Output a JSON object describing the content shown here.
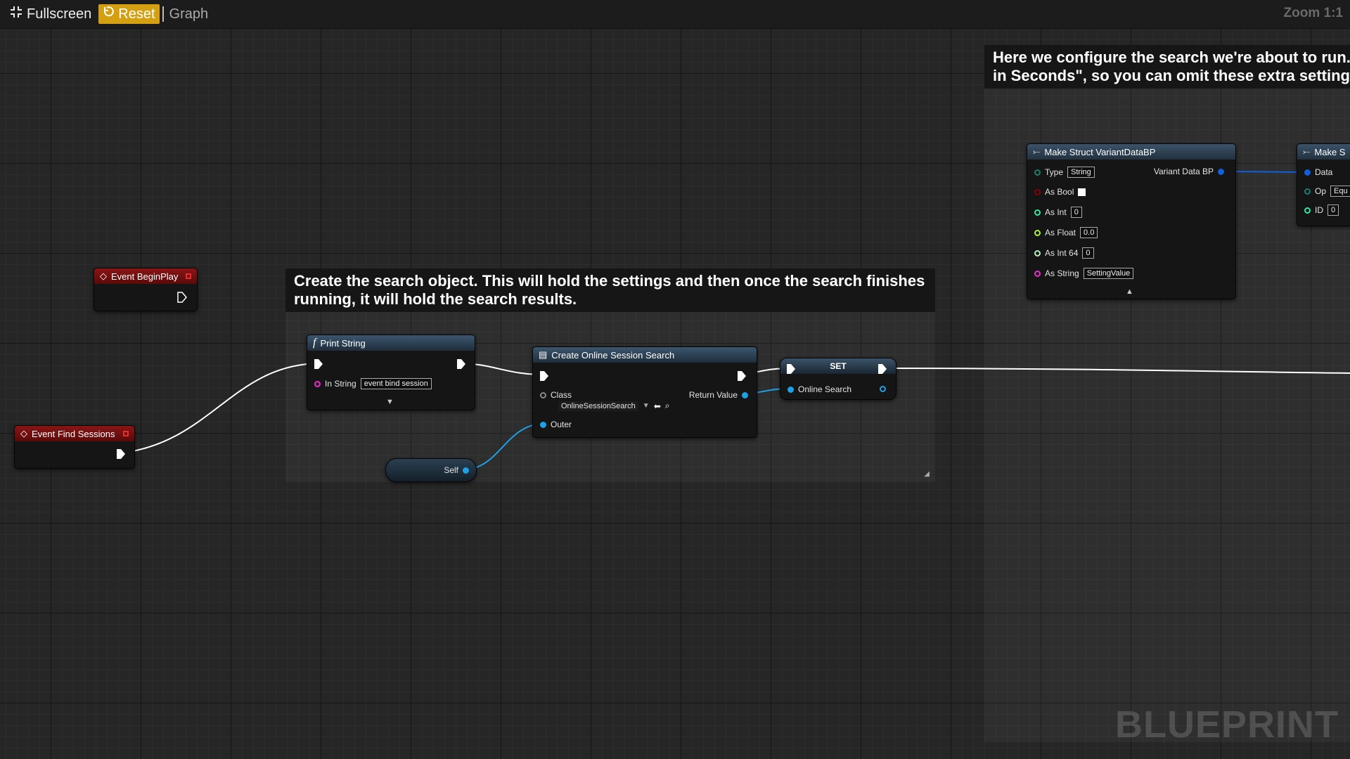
{
  "toolbar": {
    "fullscreen_label": "Fullscreen",
    "reset_label": "Reset",
    "graph_label": "Graph",
    "zoom_label": "Zoom 1:1"
  },
  "comments": {
    "search_config": "Here we configure the search we're about to run.\nin Seconds\", so you can omit these extra setting",
    "create_search": "Create the search object. This will hold the settings and then once the search finishes running, it will hold the search results."
  },
  "nodes": {
    "event_begin_play": {
      "title": "Event BeginPlay"
    },
    "event_find_sessions": {
      "title": "Event Find Sessions"
    },
    "print_string": {
      "title": "Print String",
      "in_string_label": "In String",
      "in_string_value": "event bind session"
    },
    "create_search": {
      "title": "Create Online Session Search",
      "class_label": "Class",
      "class_value": "OnlineSessionSearch",
      "return_label": "Return Value",
      "outer_label": "Outer"
    },
    "self_node": {
      "label": "Self"
    },
    "set_node": {
      "title": "SET",
      "var_label": "Online Search"
    },
    "make_struct": {
      "title": "Make Struct VariantDataBP",
      "output_label": "Variant Data BP",
      "pins": [
        {
          "label": "Type",
          "value": "String"
        },
        {
          "label": "As Bool",
          "value": ""
        },
        {
          "label": "As Int",
          "value": "0"
        },
        {
          "label": "As Float",
          "value": "0.0"
        },
        {
          "label": "As Int 64",
          "value": "0"
        },
        {
          "label": "As String",
          "value": "SettingValue"
        }
      ]
    },
    "make_struct_2": {
      "title": "Make S",
      "pins": [
        {
          "label": "Data",
          "value": ""
        },
        {
          "label": "Op",
          "value": "Equ"
        },
        {
          "label": "ID",
          "value": "0"
        }
      ]
    }
  },
  "colors": {
    "exec": "#ffffff",
    "object_pin": "#1ea0e6",
    "string_pin": "#ee2ed2",
    "bool_pin": "#8c0000",
    "int_pin": "#2ee9a4",
    "float_pin": "#a6f53c",
    "int64_pin": "#aef0c0",
    "struct_pin": "#1060e0",
    "enum_pin": "#1d7d6e",
    "event_red": "#8a1515",
    "reset_yellow": "#d4a012"
  },
  "watermark": "BLUEPRINT"
}
